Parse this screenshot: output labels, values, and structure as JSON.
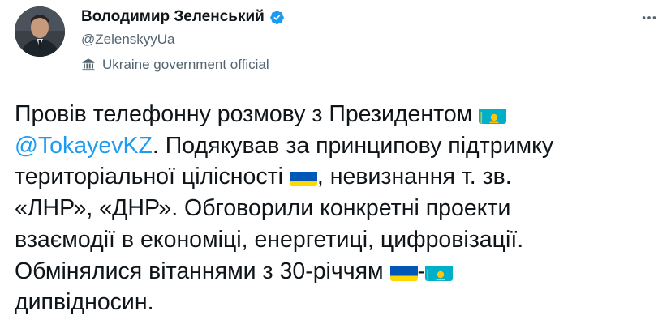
{
  "author": {
    "display_name": "Володимир Зеленський",
    "handle": "@ZelenskyyUa",
    "label": "Ukraine government official"
  },
  "tweet": {
    "line1": "Провів телефонну розмову з Президентом",
    "mention": "@TokayevKZ",
    "line2_rest": ". Подякував за принципову підтримку",
    "line3": "територіальної цілісності",
    "line3_rest": ", невизнання т. зв.",
    "line4": "«ЛНР», «ДНР». Обговорили конкретні проекти",
    "line5": "взаємодії в економіці, енергетиці, цифровізації.",
    "line6": "Обмінялися вітаннями з 30-річчям",
    "line6_dash": "-",
    "line7": "дипвідносин."
  },
  "icons": {
    "verified": "verified-badge-icon",
    "government": "government-building-icon",
    "flag_kz": "kazakhstan-flag-icon",
    "flag_ua": "ukraine-flag-icon",
    "more": "more-options-icon"
  },
  "colors": {
    "text": "#0f1419",
    "secondary": "#536471",
    "accent": "#1d9bf0",
    "ua_blue": "#0057b7",
    "ua_yellow": "#ffd700",
    "kz_blue": "#00afca",
    "kz_gold": "#fec50c"
  }
}
